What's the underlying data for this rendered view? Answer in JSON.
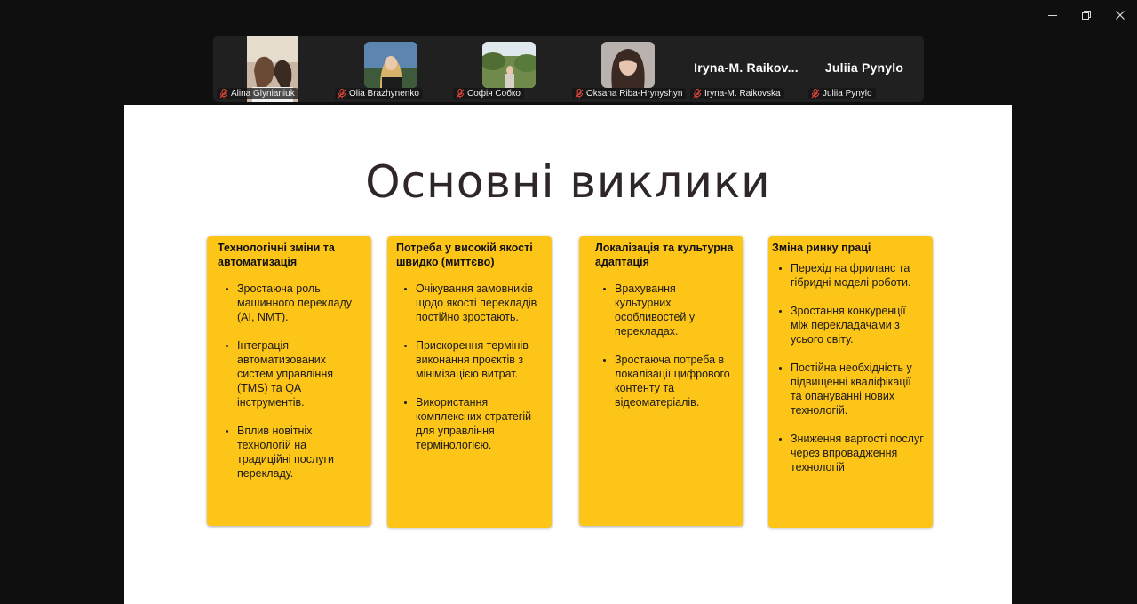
{
  "window": {
    "controls": [
      "minimize",
      "restore",
      "close"
    ]
  },
  "participants": [
    {
      "name": "Alina Glynianiuk",
      "avatar": "photo",
      "muted": true
    },
    {
      "name": "Olia Brazhynenko",
      "avatar": "photo",
      "muted": true
    },
    {
      "name": "Софія Собко",
      "avatar": "photo",
      "muted": true
    },
    {
      "name": "Oksana Riba-Hrynyshyn",
      "avatar": "photo",
      "muted": true
    },
    {
      "name": "Iryna-M. Raikovska",
      "display_name": "Iryna-M.  Raikov...",
      "avatar": "none",
      "muted": true
    },
    {
      "name": "Juliia Pynylo",
      "display_name": "Juliia Pynylo",
      "avatar": "none",
      "muted": true
    }
  ],
  "slide": {
    "title": "Основні виклики",
    "cards": [
      {
        "heading": "Технологічні зміни та автоматизація",
        "bullets": [
          "Зростаюча роль машинного перекладу (AI, NMT).",
          "Інтеграція автоматизованих систем управління (TMS) та QA інструментів.",
          "Вплив новітніх технологій на традиційні послуги перекладу."
        ]
      },
      {
        "heading": "Потреба у високій якості швидко (миттєво)",
        "bullets": [
          "Очікування замовників щодо якості перекладів постійно зростають.",
          "Прискорення термінів виконання проєктів з мінімізацією витрат.",
          "Використання комплексних стратегій для управління термінологією."
        ]
      },
      {
        "heading": "Локалізація та культурна адаптація",
        "bullets": [
          "Врахування культурних особливостей у перекладах.",
          "Зростаюча потреба в локалізації цифрового контенту та відеоматеріалів."
        ]
      },
      {
        "heading": "Зміна ринку праці",
        "bullets": [
          "Перехід на фриланс та гібридні моделі роботи.",
          "Зростання конкуренції між перекладачами з усього світу.",
          "Постійна необхідність у підвищенні кваліфікації та опануванні нових технологій.",
          "Зниження вартості послуг через впровадження технологій"
        ]
      }
    ]
  },
  "colors": {
    "card": "#fec519",
    "background": "#0f0f0f",
    "strip": "#202020",
    "mic_muted": "#e0453a"
  }
}
